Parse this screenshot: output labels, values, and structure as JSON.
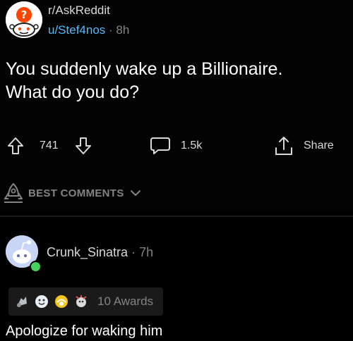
{
  "post": {
    "subreddit": "r/AskReddit",
    "author": "u/Stef4nos",
    "separator": "·",
    "age": "8h",
    "title": "You suddenly wake up a Billionaire.\nWhat do you do?",
    "votes": "741",
    "comments": "1.5k",
    "share_label": "Share"
  },
  "comments_header": {
    "sort_label": "BEST COMMENTS"
  },
  "comment": {
    "author": "Crunk_Sinatra",
    "separator": "·",
    "age": "7h",
    "awards_label": "10 Awards",
    "body": "Apologize for waking him"
  },
  "colors": {
    "background": "#030303",
    "link_blue": "#4fbcff",
    "muted": "#818384",
    "online": "#46d160"
  }
}
